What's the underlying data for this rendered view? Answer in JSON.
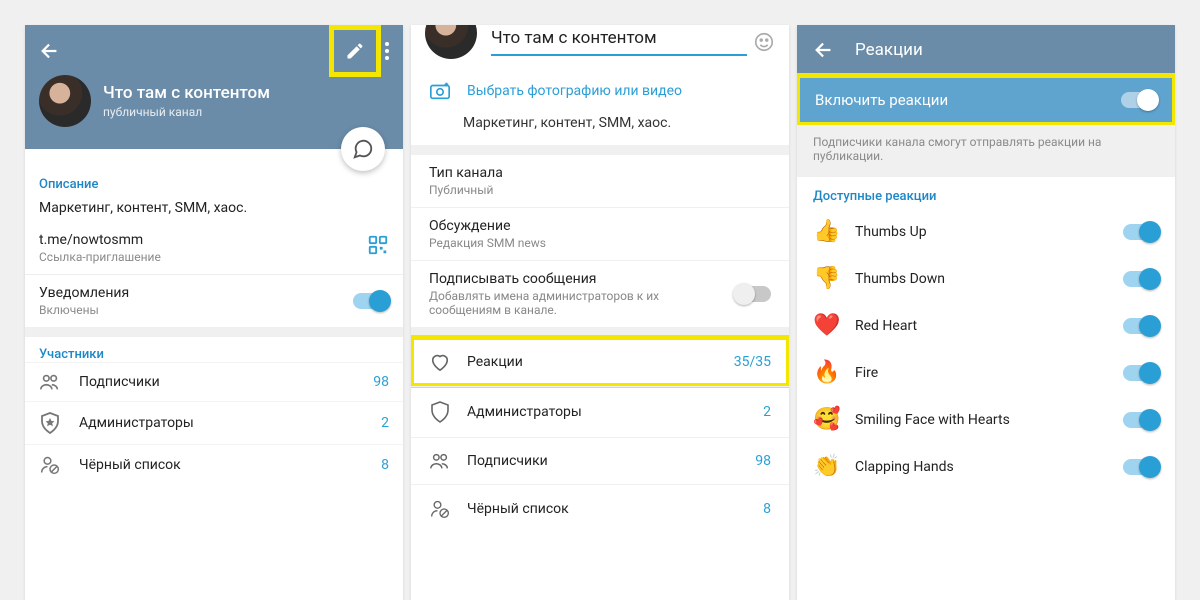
{
  "panel1": {
    "channel_name": "Что там с контентом",
    "channel_type": "публичный канал",
    "desc_label": "Описание",
    "description": "Маркетинг, контент, SMM, хаос.",
    "invite_link": "t.me/nowtosmm",
    "invite_sub": "Ссылка-приглашение",
    "notif_title": "Уведомления",
    "notif_status": "Включены",
    "members_label": "Участники",
    "rows": [
      {
        "label": "Подписчики",
        "count": "98"
      },
      {
        "label": "Администраторы",
        "count": "2"
      },
      {
        "label": "Чёрный список",
        "count": "8"
      }
    ]
  },
  "panel2": {
    "title_value": "Что там с контентом",
    "photo_action": "Выбрать фотографию или видео",
    "description": "Маркетинг, контент, SMM, хаос.",
    "type_label": "Тип канала",
    "type_value": "Публичный",
    "discussion_label": "Обсуждение",
    "discussion_value": "Редакция SMM news",
    "sign_label": "Подписывать сообщения",
    "sign_hint": "Добавлять имена администраторов к их сообщениям в канале.",
    "reactions_label": "Реакции",
    "reactions_count": "35/35",
    "rows": [
      {
        "label": "Администраторы",
        "count": "2"
      },
      {
        "label": "Подписчики",
        "count": "98"
      },
      {
        "label": "Чёрный список",
        "count": "8"
      }
    ]
  },
  "panel3": {
    "title": "Реакции",
    "enable_label": "Включить реакции",
    "hint": "Подписчики канала смогут отправлять реакции на публикации.",
    "section_label": "Доступные реакции",
    "reactions": [
      {
        "emoji": "👍",
        "name": "Thumbs Up"
      },
      {
        "emoji": "👎",
        "name": "Thumbs Down"
      },
      {
        "emoji": "❤️",
        "name": "Red Heart"
      },
      {
        "emoji": "🔥",
        "name": "Fire"
      },
      {
        "emoji": "🥰",
        "name": "Smiling Face with Hearts"
      },
      {
        "emoji": "👏",
        "name": "Clapping Hands"
      }
    ]
  }
}
